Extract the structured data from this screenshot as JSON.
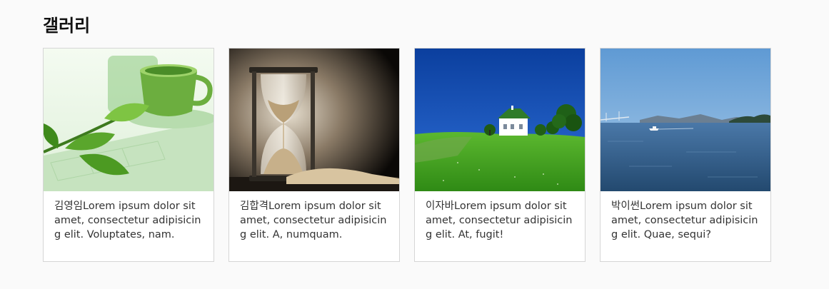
{
  "gallery": {
    "title": "갤러리",
    "cards": [
      {
        "image": "green-tea-cup-with-leaves",
        "name": "김영임",
        "text": "김영임Lorem ipsum dolor sit amet, consectetur adipisicing elit. Voluptates, nam."
      },
      {
        "image": "hourglass-with-sand",
        "name": "김합격",
        "text": "김합격Lorem ipsum dolor sit amet, consectetur adipisicing elit. A, numquam."
      },
      {
        "image": "white-house-on-green-hill",
        "name": "이자바",
        "text": "이자바Lorem ipsum dolor sit amet, consectetur adipisicing elit. At, fugit!"
      },
      {
        "image": "sea-with-bridge-and-boat",
        "name": "박이썬",
        "text": "박이썬Lorem ipsum dolor sit amet, consectetur adipisicing elit. Quae, sequi?"
      }
    ]
  }
}
